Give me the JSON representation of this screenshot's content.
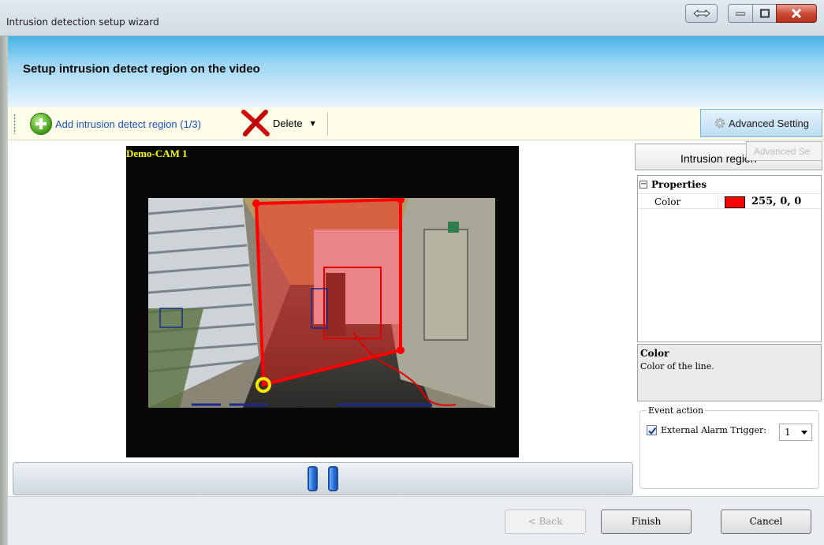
{
  "window": {
    "title": "Intrusion detection setup wizard",
    "controls": [
      "restore-icon",
      "minimize-icon",
      "maximize-icon",
      "close-icon"
    ]
  },
  "header": {
    "title": "Setup intrusion detect region on the video"
  },
  "toolbar": {
    "add_label": "Add intrusion detect region (1/3)",
    "delete_label": "Delete",
    "advanced_label": "Advanced Setting"
  },
  "video": {
    "camera_label": "Demo-CAM 1",
    "region_color": "#ff0000"
  },
  "right_panel": {
    "region_title": "Intrusion region",
    "ghost_tooltip": "Advanced Se",
    "properties": {
      "category": "Properties",
      "collapse_glyph": "−",
      "row_name": "Color",
      "row_value": "255, 0, 0",
      "swatch_color": "#ff0000"
    },
    "description": {
      "title": "Color",
      "text": "Color of the line."
    },
    "event_action": {
      "legend": "Event action",
      "checkbox_label": "External Alarm Trigger:",
      "checked": true,
      "selected_value": "1"
    }
  },
  "footer": {
    "back_label": "< Back",
    "finish_label": "Finish",
    "cancel_label": "Cancel"
  },
  "colors": {
    "header_blue": "#46b3e6",
    "toolbar_bg": "#fdfde8",
    "link_blue": "#1a4fc4",
    "close_red": "#c9472f"
  }
}
